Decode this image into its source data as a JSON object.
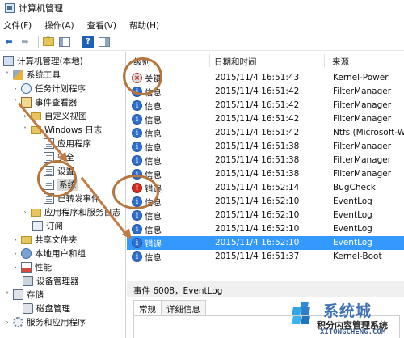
{
  "window": {
    "title": "计算机管理"
  },
  "menu": [
    "文件(F)",
    "操作(A)",
    "查看(V)",
    "帮助(H)"
  ],
  "tree": {
    "root": "计算机管理(本地)",
    "system_tools": "系统工具",
    "task_scheduler": "任务计划程序",
    "event_viewer": "事件查看器",
    "custom_views": "自定义视图",
    "windows_logs": "Windows 日志",
    "app_log": "应用程序",
    "security_log": "安全",
    "setup_log": "设置",
    "system_log": "系统",
    "forwarded_events": "已转发事件",
    "app_service_logs": "应用程序和服务日志",
    "subscriptions": "订阅",
    "shared_folders": "共享文件夹",
    "local_users_groups": "本地用户和组",
    "performance": "性能",
    "device_manager": "设备管理器",
    "storage": "存储",
    "disk_management": "磁盘管理",
    "services_apps": "服务和应用程序"
  },
  "events_table": {
    "columns": [
      "级别",
      "日期和时间",
      "来源"
    ],
    "rows": [
      {
        "level": "关键",
        "level_type": "critical",
        "datetime": "2015/11/4 16:51:43",
        "source": "Kernel-Power"
      },
      {
        "level": "信息",
        "level_type": "info",
        "datetime": "2015/11/4 16:51:42",
        "source": "FilterManager"
      },
      {
        "level": "信息",
        "level_type": "info",
        "datetime": "2015/11/4 16:51:42",
        "source": "FilterManager"
      },
      {
        "level": "信息",
        "level_type": "info",
        "datetime": "2015/11/4 16:51:42",
        "source": "FilterManager"
      },
      {
        "level": "信息",
        "level_type": "info",
        "datetime": "2015/11/4 16:51:42",
        "source": "Ntfs (Microsoft-W"
      },
      {
        "level": "信息",
        "level_type": "info",
        "datetime": "2015/11/4 16:51:38",
        "source": "FilterManager"
      },
      {
        "level": "信息",
        "level_type": "info",
        "datetime": "2015/11/4 16:51:38",
        "source": "FilterManager"
      },
      {
        "level": "信息",
        "level_type": "info",
        "datetime": "2015/11/4 16:51:38",
        "source": "FilterManager"
      },
      {
        "level": "错误",
        "level_type": "error",
        "datetime": "2015/11/4 16:52:14",
        "source": "BugCheck"
      },
      {
        "level": "信息",
        "level_type": "info",
        "datetime": "2015/11/4 16:52:10",
        "source": "EventLog"
      },
      {
        "level": "信息",
        "level_type": "info",
        "datetime": "2015/11/4 16:52:10",
        "source": "EventLog"
      },
      {
        "level": "信息",
        "level_type": "info",
        "datetime": "2015/11/4 16:52:10",
        "source": "EventLog"
      },
      {
        "level": "错误",
        "level_type": "info",
        "datetime": "2015/11/4 16:52:10",
        "source": "EventLog",
        "selected": true
      },
      {
        "level": "信息",
        "level_type": "info",
        "datetime": "2015/11/4 16:51:37",
        "source": "Kernel-Boot"
      }
    ]
  },
  "detail": {
    "title": "事件 6008，EventLog",
    "tabs": [
      "常规",
      "详细信息"
    ]
  },
  "watermark": {
    "brand": "系统城",
    "slogan": "积分内容管理系统",
    "url": "XITONGCHENG.COM"
  },
  "icons": {
    "info": "i",
    "critical": "×",
    "error": "!"
  },
  "colors": {
    "selection": "#3399ff",
    "annotation": "#b5763e"
  }
}
